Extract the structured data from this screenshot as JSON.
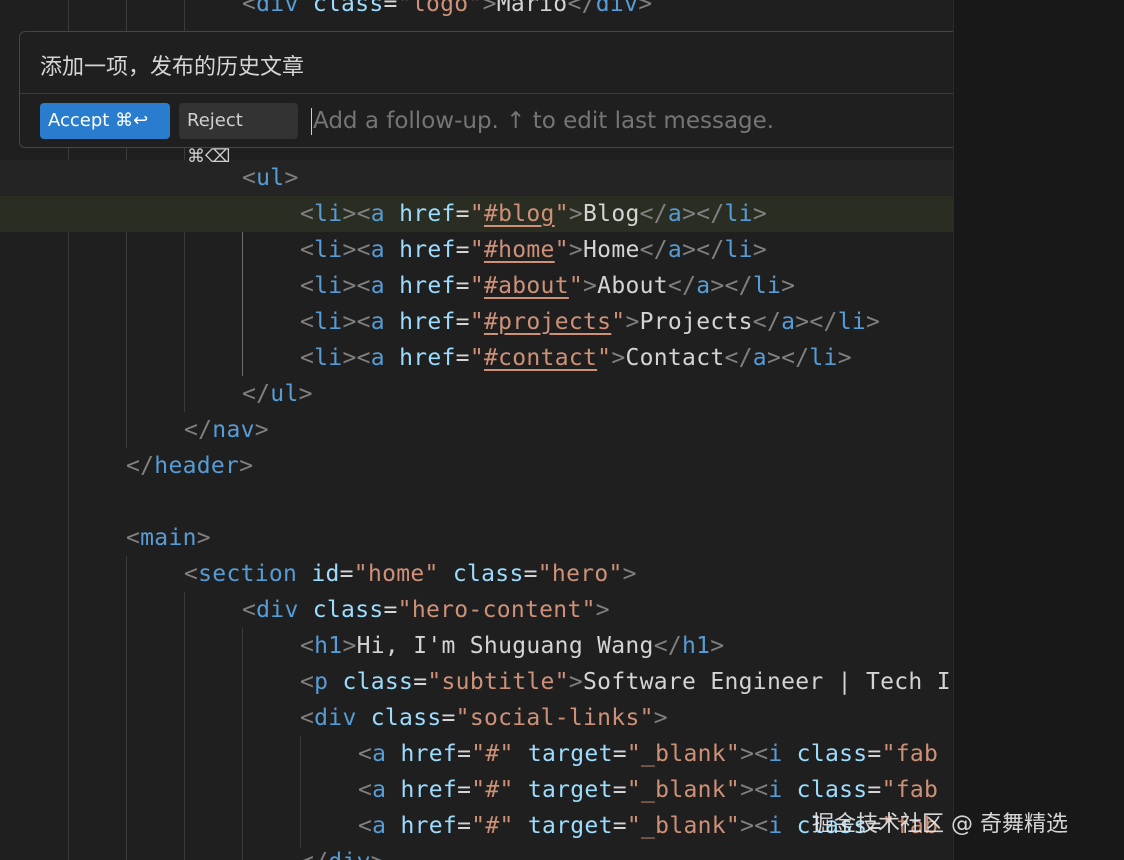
{
  "chat": {
    "prompt": "添加一项，发布的历史文章",
    "accept_label": "Accept ⌘↩",
    "reject_label": "Reject ⌘⌫",
    "followup_placeholder": "Add a follow-up. ↑ to edit last message."
  },
  "code": {
    "logo_text": "Mario",
    "nav_items": [
      {
        "href": "#blog",
        "label": "Blog"
      },
      {
        "href": "#home",
        "label": "Home"
      },
      {
        "href": "#about",
        "label": "About"
      },
      {
        "href": "#projects",
        "label": "Projects"
      },
      {
        "href": "#contact",
        "label": "Contact"
      }
    ],
    "section_id": "home",
    "section_class": "hero",
    "hero_content_class": "hero-content",
    "h1_text": "Hi, I'm Shuguang Wang",
    "subtitle_class": "subtitle",
    "subtitle_text": "Software Engineer | Tech I",
    "social_class": "social-links",
    "fab_class_partial": "fab"
  },
  "watermark": "掘金技术社区 @ 奇舞精选"
}
